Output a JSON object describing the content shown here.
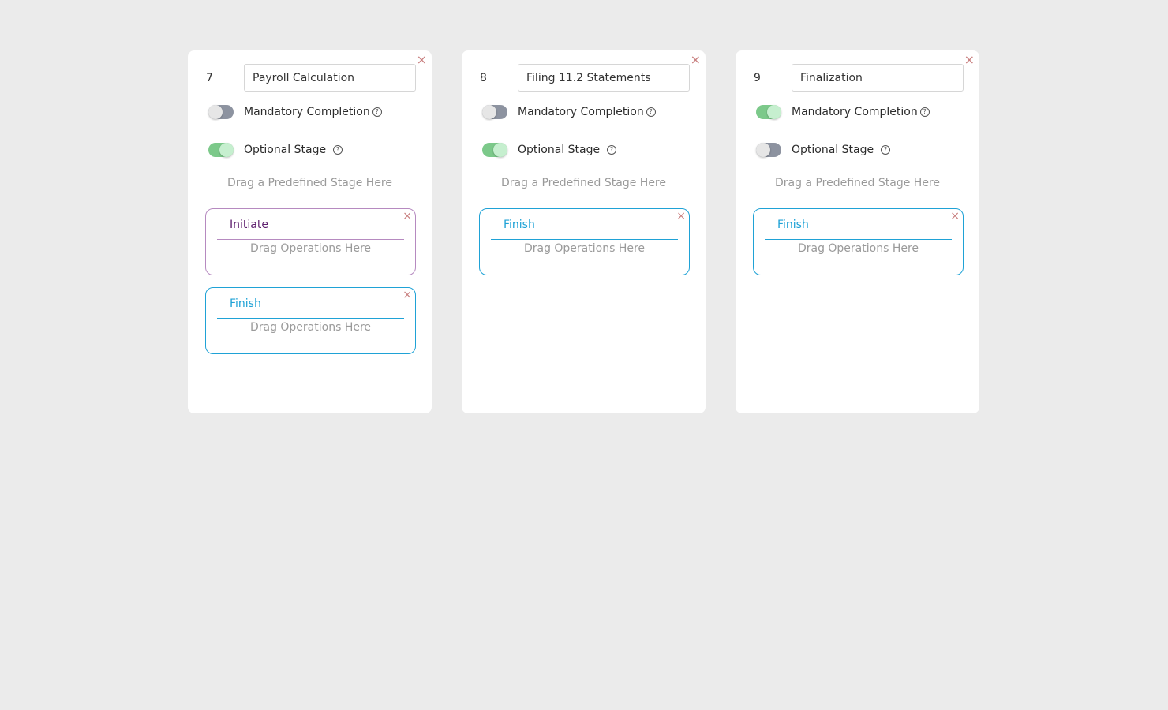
{
  "stages": [
    {
      "number": "7",
      "name": "Payroll Calculation",
      "mandatory_label": "Mandatory Completion",
      "mandatory_on": false,
      "optional_label": "Optional Stage",
      "optional_on": true,
      "drag_stage_hint": "Drag a Predefined Stage Here",
      "operations": [
        {
          "title": "Initiate",
          "hint": "Drag Operations Here",
          "color": "#b68ac0"
        },
        {
          "title": "Finish",
          "hint": "Drag Operations Here",
          "color": "#1fa2d6"
        }
      ]
    },
    {
      "number": "8",
      "name": "Filing 11.2 Statements",
      "mandatory_label": "Mandatory Completion",
      "mandatory_on": false,
      "optional_label": "Optional Stage",
      "optional_on": true,
      "drag_stage_hint": "Drag a Predefined Stage Here",
      "operations": [
        {
          "title": "Finish",
          "hint": "Drag Operations Here",
          "color": "#1fa2d6"
        }
      ]
    },
    {
      "number": "9",
      "name": "Finalization",
      "mandatory_label": "Mandatory Completion",
      "mandatory_on": true,
      "optional_label": "Optional Stage",
      "optional_on": false,
      "drag_stage_hint": "Drag a Predefined Stage Here",
      "operations": [
        {
          "title": "Finish",
          "hint": "Drag Operations Here",
          "color": "#1fa2d6"
        }
      ]
    }
  ],
  "icons": {
    "close": "×",
    "help": "?"
  },
  "colors": {
    "toggle_on": "#7cc98a",
    "toggle_off": "#8d93a0",
    "finish_accent": "#1fa2d6",
    "initiate_accent": "#b68ac0",
    "close_icon": "#c98080"
  }
}
